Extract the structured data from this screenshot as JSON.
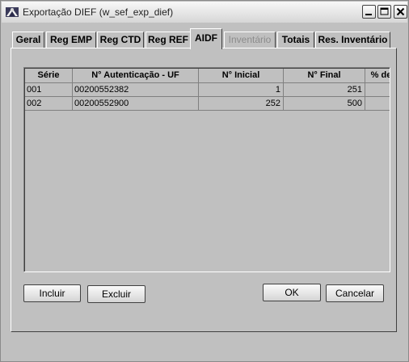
{
  "window": {
    "title": "Exportação DIEF (w_sef_exp_dief)",
    "icon": "application-icon"
  },
  "tabs": [
    {
      "label": "Geral",
      "active": false,
      "enabled": true
    },
    {
      "label": "Reg EMP",
      "active": false,
      "enabled": true
    },
    {
      "label": "Reg CTD",
      "active": false,
      "enabled": true
    },
    {
      "label": "Reg REF",
      "active": false,
      "enabled": true
    },
    {
      "label": "AIDF",
      "active": true,
      "enabled": true
    },
    {
      "label": "Inventário",
      "active": false,
      "enabled": false
    },
    {
      "label": "Totais",
      "active": false,
      "enabled": true
    },
    {
      "label": "Res. Inventário",
      "active": false,
      "enabled": true
    }
  ],
  "grid": {
    "columns": [
      "Série",
      "N° Autenticação - UF",
      "N° Inicial",
      "N° Final",
      "% de"
    ],
    "rows": [
      [
        "001",
        "00200552382",
        "1",
        "251",
        ""
      ],
      [
        "002",
        "00200552900",
        "252",
        "500",
        ""
      ]
    ]
  },
  "buttons": {
    "incluir": "Incluir",
    "excluir": "Excluir",
    "ok": "OK",
    "cancelar": "Cancelar"
  }
}
